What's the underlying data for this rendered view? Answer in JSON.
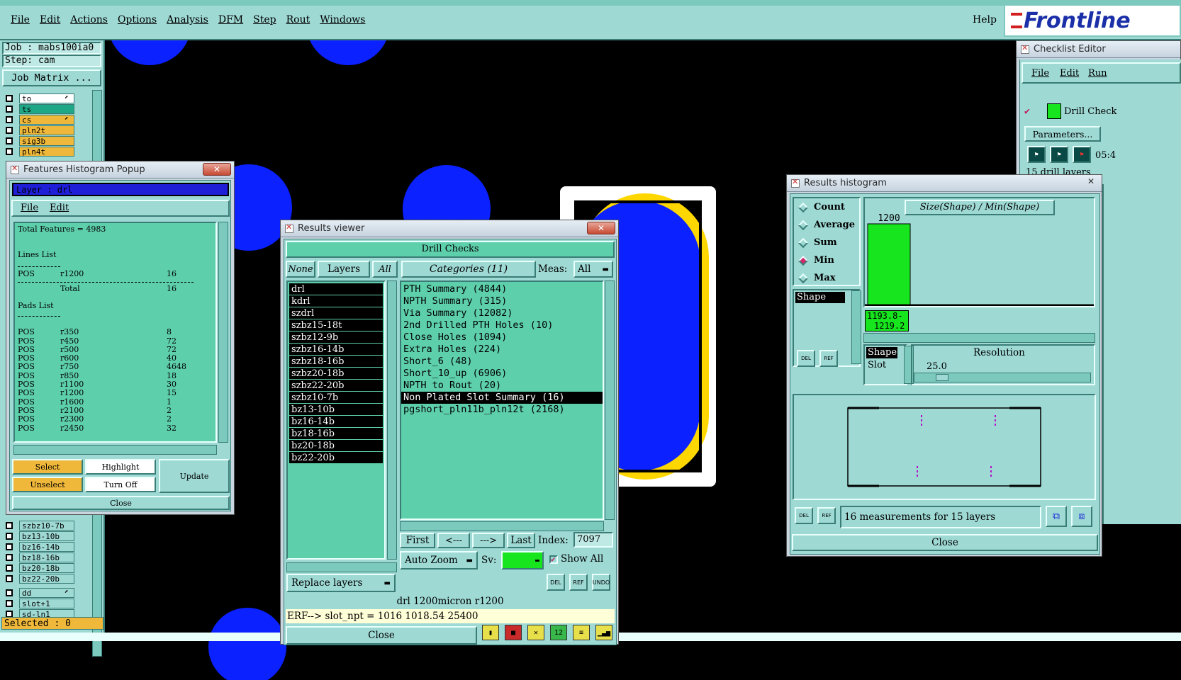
{
  "menubar": {
    "items": [
      "File",
      "Edit",
      "Actions",
      "Options",
      "Analysis",
      "DFM",
      "Step",
      "Rout",
      "Windows"
    ],
    "help": "Help",
    "logo": "Frontline"
  },
  "left_panel": {
    "job": "Job : mabs100ia0",
    "step": "Step: cam",
    "job_matrix": "Job Matrix ...",
    "layers_top": [
      {
        "name": "to",
        "color": "#ffffff",
        "mark": "⬈"
      },
      {
        "name": "ts",
        "color": "#1fa886",
        "mark": ""
      },
      {
        "name": "cs",
        "color": "#f0b83a",
        "mark": "⬈"
      },
      {
        "name": "pln2t",
        "color": "#f0b83a",
        "mark": ""
      },
      {
        "name": "sig3b",
        "color": "#f0b83a",
        "mark": ""
      },
      {
        "name": "pln4t",
        "color": "#f0b83a",
        "mark": ""
      }
    ],
    "layers_bottom": [
      {
        "name": "szbz10-7b",
        "color": "#9ed9d4",
        "mark": ""
      },
      {
        "name": "bz13-10b",
        "color": "#9ed9d4",
        "mark": ""
      },
      {
        "name": "bz16-14b",
        "color": "#9ed9d4",
        "mark": ""
      },
      {
        "name": "bz18-16b",
        "color": "#9ed9d4",
        "mark": ""
      },
      {
        "name": "bz20-18b",
        "color": "#9ed9d4",
        "mark": ""
      },
      {
        "name": "bz22-20b",
        "color": "#9ed9d4",
        "mark": ""
      }
    ],
    "layers_extra": [
      {
        "name": "dd",
        "color": "#9ed9d4",
        "mark": "⬈"
      },
      {
        "name": "slot+1",
        "color": "#9ed9d4",
        "mark": ""
      },
      {
        "name": "sd-ln1",
        "color": "#9ed9d4",
        "mark": ""
      }
    ],
    "selected": "Selected : 0"
  },
  "features_popup": {
    "title": "Features Histogram Popup",
    "layer": "Layer :  drl",
    "menu": [
      "File",
      "Edit"
    ],
    "total": "Total Features = 4983",
    "lines_header": "Lines List",
    "lines": [
      {
        "a": "POS",
        "b": "r1200",
        "c": "16"
      }
    ],
    "lines_total_label": "Total",
    "lines_total": "16",
    "pads_header": "Pads List",
    "pads": [
      {
        "a": "POS",
        "b": "r350",
        "c": "8"
      },
      {
        "a": "POS",
        "b": "r450",
        "c": "72"
      },
      {
        "a": "POS",
        "b": "r500",
        "c": "72"
      },
      {
        "a": "POS",
        "b": "r600",
        "c": "40"
      },
      {
        "a": "POS",
        "b": "r750",
        "c": "4648"
      },
      {
        "a": "POS",
        "b": "r850",
        "c": "18"
      },
      {
        "a": "POS",
        "b": "r1100",
        "c": "30"
      },
      {
        "a": "POS",
        "b": "r1200",
        "c": "15"
      },
      {
        "a": "POS",
        "b": "r1600",
        "c": "1"
      },
      {
        "a": "POS",
        "b": "r2100",
        "c": "2"
      },
      {
        "a": "POS",
        "b": "r2300",
        "c": "2"
      },
      {
        "a": "POS",
        "b": "r2450",
        "c": "32"
      }
    ],
    "select": "Select",
    "highlight": "Highlight",
    "update": "Update",
    "unselect": "Unselect",
    "turn_off": "Turn Off",
    "close": "Close"
  },
  "results_viewer": {
    "title": "Results viewer",
    "header": "Drill Checks",
    "none": "None",
    "layers": "Layers",
    "all": "All",
    "categories": "Categories (11)",
    "meas_label": "Meas:",
    "meas_value": "All",
    "layer_list": [
      "drl",
      "kdrl",
      "szdrl",
      "szbz15-18t",
      "szbz12-9b",
      "szbz16-14b",
      "szbz18-16b",
      "szbz20-18b",
      "szbz22-20b",
      "szbz10-7b",
      "bz13-10b",
      "bz16-14b",
      "bz18-16b",
      "bz20-18b",
      "bz22-20b"
    ],
    "category_list": [
      "PTH Summary (4844)",
      "NPTH Summary (315)",
      "Via Summary (12082)",
      "2nd Drilled PTH Holes (10)",
      "Close Holes (1094)",
      "Extra Holes (224)",
      "Short_6 (48)",
      "Short_10_up (6906)",
      "NPTH to Rout (20)",
      "Non Plated Slot Summary (16)",
      "pgshort_pln11b_pln12t (2168)"
    ],
    "selected_category_index": 9,
    "first": "First",
    "prev": "<---",
    "next": "--->",
    "last": "Last",
    "index_label": "Index:",
    "index_value": "7097",
    "auto_zoom": "Auto Zoom",
    "sv_label": "Sv:",
    "show_all": "Show All",
    "replace_layers": "Replace layers",
    "del": "DEL",
    "ref": "REF",
    "undo": "UNDO",
    "status1": "drl 1200micron  r1200",
    "status2": "ERF--> slot_npt = 1016 1018.54 25400",
    "close": "Close"
  },
  "checklist_editor": {
    "title": "Checklist Editor",
    "menu": [
      "File",
      "Edit",
      "Run"
    ],
    "item": "Drill Check",
    "parameters": "Parameters...",
    "time": "05:4",
    "info": "15 drill layers"
  },
  "results_histogram": {
    "title": "Results histogram",
    "options": [
      "Count",
      "Average",
      "Sum",
      "Min",
      "Max"
    ],
    "selected_option": "Min",
    "chart_title": "Size(Shape) / Min(Shape)",
    "bar_label": "1200",
    "bar_value": 1200,
    "bar_range_1": "1193.8-",
    "bar_range_2": "1219.2",
    "list1": [
      "Shape"
    ],
    "list2": [
      "Shape",
      "Slot"
    ],
    "resolution_label": "Resolution",
    "resolution_value": "25.0",
    "del": "DEL",
    "ref": "REF",
    "measurements": "16 measurements for 15 layers",
    "close": "Close"
  },
  "colors": {
    "teal": "#9ed9d4",
    "green": "#5ecfab",
    "copper_blue": "#0b21ff",
    "outline_yellow": "#ffd700",
    "bar_green": "#17e61e"
  }
}
